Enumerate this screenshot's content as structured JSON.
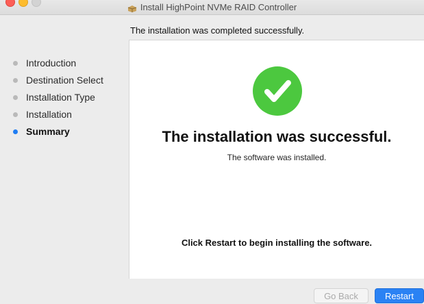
{
  "window": {
    "title": "Install HighPoint NVMe RAID Controller",
    "app_icon": "package-icon"
  },
  "header": {
    "message": "The installation was completed successfully."
  },
  "sidebar": {
    "steps": [
      {
        "label": "Introduction",
        "active": false
      },
      {
        "label": "Destination Select",
        "active": false
      },
      {
        "label": "Installation Type",
        "active": false
      },
      {
        "label": "Installation",
        "active": false
      },
      {
        "label": "Summary",
        "active": true
      }
    ]
  },
  "main": {
    "status_icon": "checkmark-icon",
    "title": "The installation was successful.",
    "subtitle": "The software was installed.",
    "restart_message": "Click Restart to begin installing the software."
  },
  "buttons": {
    "go_back": "Go Back",
    "restart": "Restart"
  },
  "colors": {
    "accent": "#2a82f4",
    "success": "#4cc83f",
    "active_step_dot": "#1f7df3"
  }
}
